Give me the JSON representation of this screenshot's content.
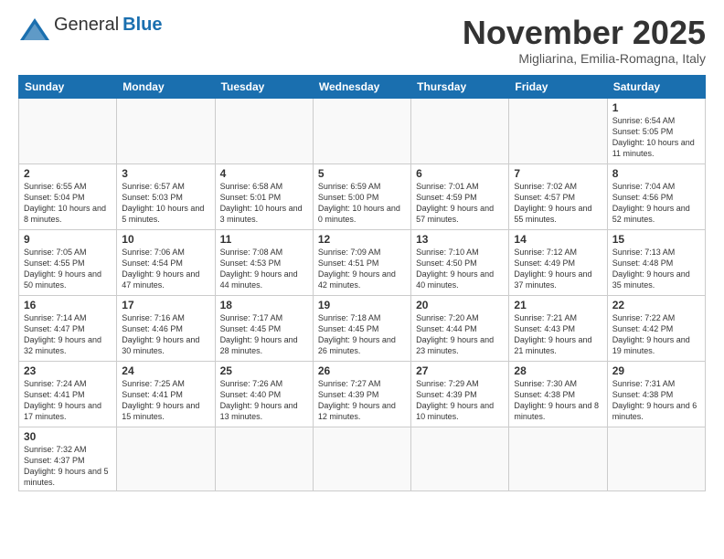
{
  "header": {
    "logo_general": "General",
    "logo_blue": "Blue",
    "title": "November 2025",
    "subtitle": "Migliarina, Emilia-Romagna, Italy"
  },
  "weekdays": [
    "Sunday",
    "Monday",
    "Tuesday",
    "Wednesday",
    "Thursday",
    "Friday",
    "Saturday"
  ],
  "weeks": [
    [
      {
        "day": "",
        "info": ""
      },
      {
        "day": "",
        "info": ""
      },
      {
        "day": "",
        "info": ""
      },
      {
        "day": "",
        "info": ""
      },
      {
        "day": "",
        "info": ""
      },
      {
        "day": "",
        "info": ""
      },
      {
        "day": "1",
        "info": "Sunrise: 6:54 AM\nSunset: 5:05 PM\nDaylight: 10 hours and 11 minutes."
      }
    ],
    [
      {
        "day": "2",
        "info": "Sunrise: 6:55 AM\nSunset: 5:04 PM\nDaylight: 10 hours and 8 minutes."
      },
      {
        "day": "3",
        "info": "Sunrise: 6:57 AM\nSunset: 5:03 PM\nDaylight: 10 hours and 5 minutes."
      },
      {
        "day": "4",
        "info": "Sunrise: 6:58 AM\nSunset: 5:01 PM\nDaylight: 10 hours and 3 minutes."
      },
      {
        "day": "5",
        "info": "Sunrise: 6:59 AM\nSunset: 5:00 PM\nDaylight: 10 hours and 0 minutes."
      },
      {
        "day": "6",
        "info": "Sunrise: 7:01 AM\nSunset: 4:59 PM\nDaylight: 9 hours and 57 minutes."
      },
      {
        "day": "7",
        "info": "Sunrise: 7:02 AM\nSunset: 4:57 PM\nDaylight: 9 hours and 55 minutes."
      },
      {
        "day": "8",
        "info": "Sunrise: 7:04 AM\nSunset: 4:56 PM\nDaylight: 9 hours and 52 minutes."
      }
    ],
    [
      {
        "day": "9",
        "info": "Sunrise: 7:05 AM\nSunset: 4:55 PM\nDaylight: 9 hours and 50 minutes."
      },
      {
        "day": "10",
        "info": "Sunrise: 7:06 AM\nSunset: 4:54 PM\nDaylight: 9 hours and 47 minutes."
      },
      {
        "day": "11",
        "info": "Sunrise: 7:08 AM\nSunset: 4:53 PM\nDaylight: 9 hours and 44 minutes."
      },
      {
        "day": "12",
        "info": "Sunrise: 7:09 AM\nSunset: 4:51 PM\nDaylight: 9 hours and 42 minutes."
      },
      {
        "day": "13",
        "info": "Sunrise: 7:10 AM\nSunset: 4:50 PM\nDaylight: 9 hours and 40 minutes."
      },
      {
        "day": "14",
        "info": "Sunrise: 7:12 AM\nSunset: 4:49 PM\nDaylight: 9 hours and 37 minutes."
      },
      {
        "day": "15",
        "info": "Sunrise: 7:13 AM\nSunset: 4:48 PM\nDaylight: 9 hours and 35 minutes."
      }
    ],
    [
      {
        "day": "16",
        "info": "Sunrise: 7:14 AM\nSunset: 4:47 PM\nDaylight: 9 hours and 32 minutes."
      },
      {
        "day": "17",
        "info": "Sunrise: 7:16 AM\nSunset: 4:46 PM\nDaylight: 9 hours and 30 minutes."
      },
      {
        "day": "18",
        "info": "Sunrise: 7:17 AM\nSunset: 4:45 PM\nDaylight: 9 hours and 28 minutes."
      },
      {
        "day": "19",
        "info": "Sunrise: 7:18 AM\nSunset: 4:45 PM\nDaylight: 9 hours and 26 minutes."
      },
      {
        "day": "20",
        "info": "Sunrise: 7:20 AM\nSunset: 4:44 PM\nDaylight: 9 hours and 23 minutes."
      },
      {
        "day": "21",
        "info": "Sunrise: 7:21 AM\nSunset: 4:43 PM\nDaylight: 9 hours and 21 minutes."
      },
      {
        "day": "22",
        "info": "Sunrise: 7:22 AM\nSunset: 4:42 PM\nDaylight: 9 hours and 19 minutes."
      }
    ],
    [
      {
        "day": "23",
        "info": "Sunrise: 7:24 AM\nSunset: 4:41 PM\nDaylight: 9 hours and 17 minutes."
      },
      {
        "day": "24",
        "info": "Sunrise: 7:25 AM\nSunset: 4:41 PM\nDaylight: 9 hours and 15 minutes."
      },
      {
        "day": "25",
        "info": "Sunrise: 7:26 AM\nSunset: 4:40 PM\nDaylight: 9 hours and 13 minutes."
      },
      {
        "day": "26",
        "info": "Sunrise: 7:27 AM\nSunset: 4:39 PM\nDaylight: 9 hours and 12 minutes."
      },
      {
        "day": "27",
        "info": "Sunrise: 7:29 AM\nSunset: 4:39 PM\nDaylight: 9 hours and 10 minutes."
      },
      {
        "day": "28",
        "info": "Sunrise: 7:30 AM\nSunset: 4:38 PM\nDaylight: 9 hours and 8 minutes."
      },
      {
        "day": "29",
        "info": "Sunrise: 7:31 AM\nSunset: 4:38 PM\nDaylight: 9 hours and 6 minutes."
      }
    ],
    [
      {
        "day": "30",
        "info": "Sunrise: 7:32 AM\nSunset: 4:37 PM\nDaylight: 9 hours and 5 minutes."
      },
      {
        "day": "",
        "info": ""
      },
      {
        "day": "",
        "info": ""
      },
      {
        "day": "",
        "info": ""
      },
      {
        "day": "",
        "info": ""
      },
      {
        "day": "",
        "info": ""
      },
      {
        "day": "",
        "info": ""
      }
    ]
  ]
}
